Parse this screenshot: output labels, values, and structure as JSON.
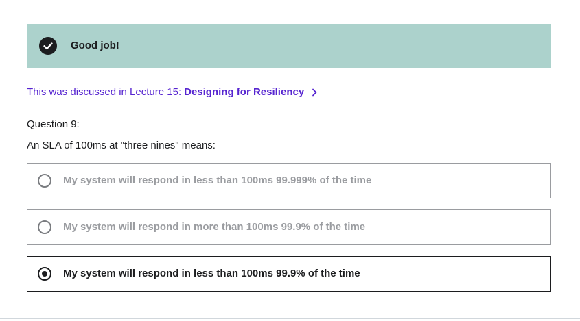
{
  "feedback": {
    "message": "Good job!"
  },
  "lecture_link": {
    "prefix": "This was discussed in Lecture 15:",
    "title": "Designing for Resiliency"
  },
  "question": {
    "number_label": "Question 9:",
    "prompt": "An SLA of 100ms at \"three nines\" means:",
    "options": [
      {
        "label": "My system will respond in less than 100ms 99.999% of the time",
        "selected": false
      },
      {
        "label": "My system will respond in more than 100ms 99.9% of the time",
        "selected": false
      },
      {
        "label": "My system will respond in less than 100ms 99.9% of the time",
        "selected": true
      }
    ]
  },
  "colors": {
    "success_banner": "#acd2cc",
    "link": "#5624d0",
    "text": "#1c1d1f",
    "muted": "#9a9ca0"
  }
}
